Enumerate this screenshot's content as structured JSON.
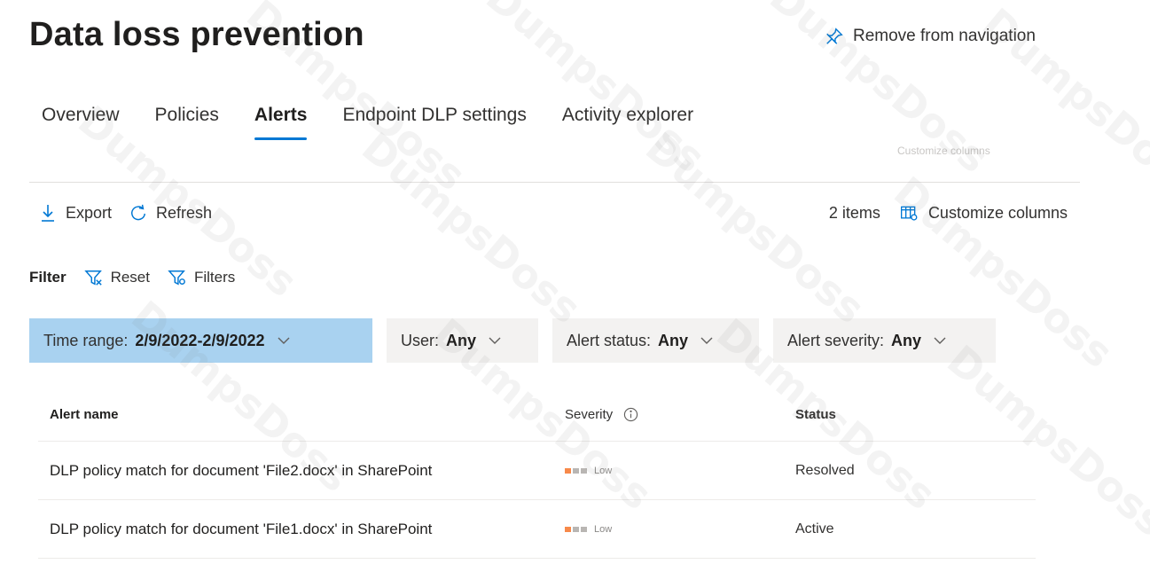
{
  "header": {
    "title": "Data loss prevention",
    "remove_nav_label": "Remove from navigation",
    "remove_nav_icon": "unpin-icon"
  },
  "tabs": [
    {
      "label": "Overview",
      "active": false
    },
    {
      "label": "Policies",
      "active": false
    },
    {
      "label": "Alerts",
      "active": true
    },
    {
      "label": "Endpoint DLP settings",
      "active": false
    },
    {
      "label": "Activity explorer",
      "active": false
    }
  ],
  "ghost_text": "Customize columns",
  "toolbar": {
    "export_label": "Export",
    "export_icon": "download-icon",
    "refresh_label": "Refresh",
    "refresh_icon": "refresh-icon",
    "item_count": "2 items",
    "customize_label": "Customize columns",
    "customize_icon": "columns-icon"
  },
  "filter": {
    "label": "Filter",
    "reset_label": "Reset",
    "reset_icon": "filter-reset-icon",
    "filters_label": "Filters",
    "filters_icon": "filter-settings-icon"
  },
  "pills": [
    {
      "key": "Time range:",
      "value": "2/9/2022-2/9/2022",
      "selected": true
    },
    {
      "key": "User:",
      "value": "Any",
      "selected": false
    },
    {
      "key": "Alert status:",
      "value": "Any",
      "selected": false
    },
    {
      "key": "Alert severity:",
      "value": "Any",
      "selected": false
    }
  ],
  "table": {
    "columns": {
      "name": "Alert name",
      "severity": "Severity",
      "status": "Status"
    },
    "rows": [
      {
        "name": "DLP policy match for document 'File2.docx' in SharePoint",
        "severity": "Low",
        "severity_level": 1,
        "status": "Resolved"
      },
      {
        "name": "DLP policy match for document 'File1.docx' in SharePoint",
        "severity": "Low",
        "severity_level": 1,
        "status": "Active"
      }
    ]
  },
  "colors": {
    "accent": "#0078d4",
    "selected_pill": "#a9d2f0",
    "pill": "#f3f2f1",
    "severity_low": "#f7894a"
  },
  "watermark": "DumpsDoss"
}
